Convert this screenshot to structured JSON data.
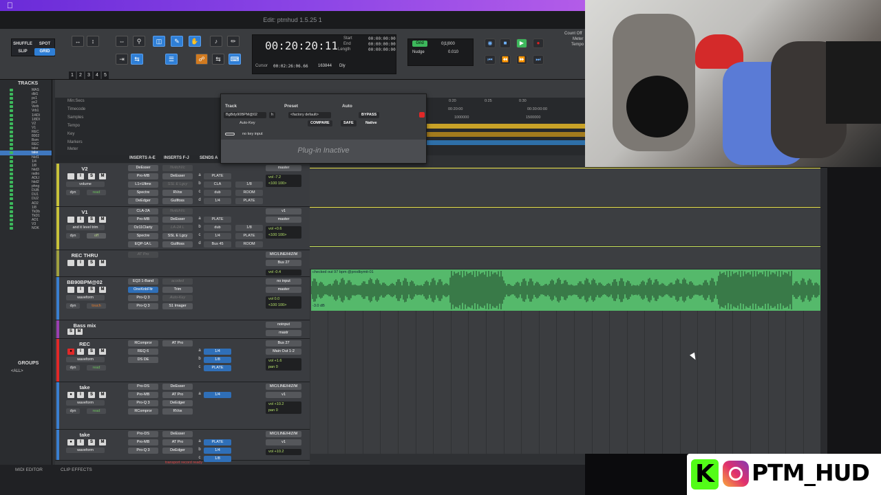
{
  "window": {
    "title": "Edit: ptmhud 1.5.25 1"
  },
  "modes": {
    "shuffle": "SHUFFLE",
    "spot": "SPOT",
    "slip": "SLIP",
    "grid": "GRID"
  },
  "toolbar": {
    "nums": [
      "1",
      "2",
      "3",
      "4",
      "5"
    ]
  },
  "counter": {
    "main": "00:20:20:11",
    "start_label": "Start",
    "end_label": "End",
    "length_label": "Length",
    "start": "00:00:00:00",
    "end": "00:00:00:00",
    "length": "00:00:00:00",
    "cursor_label": "Cursor",
    "cursor": "00:02:26:06.66",
    "samples": "163844",
    "dly": "Dly"
  },
  "grid": {
    "label": "Grid",
    "value": "0|1|000",
    "nudge_label": "Nudge",
    "nudge": "0.010"
  },
  "transport": {
    "count_off": "Count Off",
    "meter": "Meter",
    "tempo": "Tempo"
  },
  "tracks_panel": {
    "title": "TRACKS",
    "items": [
      "MAS",
      "dbl1",
      "pc1",
      "pc2",
      "Verb",
      "Vrb1",
      "1/4DI",
      "1/8DI",
      "V2",
      "V1",
      "REC",
      "8002",
      "Bsm",
      "REC",
      "take",
      "take",
      "hkd1",
      "1/4",
      "1/8",
      "hkd3",
      "radio",
      "ADLI",
      "hkd2",
      "phng",
      "DUB",
      "DU1",
      "DU2",
      "AD2",
      "1/8",
      "TkDb",
      "TkD1",
      "AD1",
      "V3",
      "NOK"
    ],
    "selected": 15
  },
  "groups": {
    "title": "GROUPS",
    "all": "<ALL>"
  },
  "rulers": [
    "Min:Secs",
    "Timecode",
    "Samples",
    "Tempo",
    "Key",
    "Markers",
    "Meter"
  ],
  "ruler_ticks": [
    "0:20",
    "0:25",
    "0:30",
    "00:20:00",
    "00:30:00:00",
    "1000000",
    "1500000"
  ],
  "mix": {
    "headers": {
      "a": "INSERTS A-E",
      "b": "INSERTS F-J",
      "c": "SENDS A"
    }
  },
  "tracks": [
    {
      "name": "V2",
      "color": "#c8c23a",
      "view": "volume",
      "mode": "read",
      "ins_a": [
        "DeEsser",
        "Pro-MB",
        "L1+Ultmx",
        "Spectre",
        "DeEdger"
      ],
      "ins_b": [
        "NvitchVc",
        "DeEsser",
        "SSL E Lgcy",
        "RVox",
        "Gullfoss"
      ],
      "sends": [
        "PLATE",
        "CLA",
        "dub",
        "1/4"
      ],
      "sends2": [
        "1/8",
        "ROOM",
        "PLATE"
      ],
      "io": [
        "master"
      ],
      "vol": "vol -7.2",
      "pan": "<100  100>"
    },
    {
      "name": "V1",
      "color": "#c8c23a",
      "view": "and it level trim",
      "mode": "off",
      "ins_a": [
        "CLA-2A",
        "Pro-MB",
        "Oz11Clarty",
        "Spectre",
        "EQP-1A L"
      ],
      "ins_b": [
        "NvitchVc",
        "DeEsser",
        "LA-2A L",
        "SSL E Lgcy",
        "Gullfoss"
      ],
      "sends": [
        "PLATE",
        "dub",
        "1/4",
        "Bus 45"
      ],
      "sends2": [
        "1/8",
        "PLATE",
        "ROOM"
      ],
      "io": [
        "v1",
        "master"
      ],
      "vol": "vol +0.6",
      "pan": "<100  100>"
    },
    {
      "name": "REC THRU",
      "color": "#a0a040",
      "io": [
        "MIC/LINE/HIZ/M",
        "Bus 27"
      ],
      "vol": "vol -0.4",
      "ins_a": [
        "AT Pro"
      ]
    },
    {
      "name": "BB90BPM@02",
      "color": "#3a7fd0",
      "view": "waveform",
      "mode": "touch",
      "ins_a": [
        "EQ3 1-Band",
        "OneKnbFltr",
        "Pro-Q 3",
        "Pro-Q 3"
      ],
      "ins_b": [
        "acoded",
        "Trim",
        "Auto-Key",
        "S1 Imager"
      ],
      "io": [
        "no input",
        "master"
      ],
      "vol": "vol 0.0",
      "pan": "<100  100>"
    },
    {
      "name": "Bass mix",
      "color": "#9a40b0",
      "io": [
        "noinput",
        "mastr"
      ],
      "vol": "0.0",
      "io_extra": "P P"
    },
    {
      "name": "REC",
      "color": "#e02828",
      "view": "waveform",
      "mode": "read",
      "ins_a": [
        "RCompror",
        "REQ 6",
        "DS DE"
      ],
      "ins_b": [
        "AT Pro"
      ],
      "sends": [
        "1/4",
        "1/8",
        "PLATE"
      ],
      "io": [
        "Bus 27",
        "Main Out 1-2"
      ],
      "vol": "vol +1.6",
      "pan": "pan  0"
    },
    {
      "name": "take",
      "color": "#3a7fd0",
      "view": "waveform",
      "mode": "read",
      "ins_a": [
        "Pro-DS",
        "Pro-MB",
        "Pro-Q 3",
        "RCompror"
      ],
      "ins_b": [
        "DeEsser",
        "AT Pro",
        "DeEdger",
        "RVox"
      ],
      "sends": [
        "1/4"
      ],
      "io": [
        "MIC/LINE/HIZ/M",
        "v1"
      ],
      "vol": "vol +10.2",
      "pan": "pan  0"
    },
    {
      "name": "take",
      "color": "#3a7fd0",
      "view": "waveform",
      "ins_a": [
        "Pro-DS",
        "Pro-MB",
        "Pro-Q 3"
      ],
      "ins_b": [
        "DeEsser",
        "AT Pro",
        "DeEdger"
      ],
      "sends": [
        "PLATE",
        "1/4",
        "1/8"
      ],
      "io": [
        "MIC/LINE/HIZ/M",
        "v1"
      ],
      "vol": "vol +10.2"
    }
  ],
  "clip": {
    "name": "checked out 97 bpm @prodbymit-01",
    "db": "-3.0 dB"
  },
  "plugin": {
    "track_label": "Track",
    "preset_label": "Preset",
    "auto_label": "Auto",
    "track": "BgBdy90BPM@02",
    "insert": "h",
    "preset": "<factory default>",
    "bypass": "BYPASS",
    "compare": "COMPARE",
    "safe": "SAFE",
    "native": "Native",
    "plugin_name": "Auto-Key",
    "key_input": "no key input",
    "inactive": "Plug-in Inactive"
  },
  "bottom": {
    "midi_editor": "MIDI EDITOR",
    "clip_effects": "CLIP EFFECTS",
    "status": "transport record ready"
  },
  "branding": {
    "kick": "K",
    "handle": "PTM_HUD"
  },
  "colors": {
    "accent": "#2f7fd6",
    "wave": "#55b96b",
    "rec": "#e02828",
    "kick": "#53fc18"
  }
}
